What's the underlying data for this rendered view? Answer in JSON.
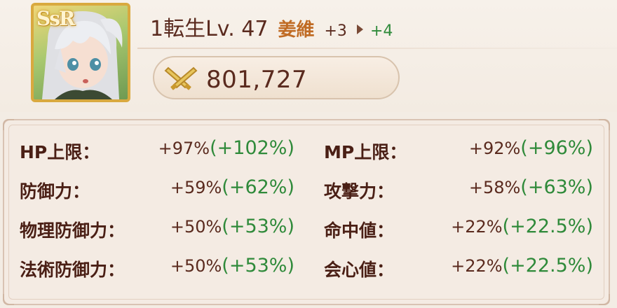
{
  "character": {
    "rarity": "SsR",
    "portrait": "white-haired-girl-portrait"
  },
  "header": {
    "rebirth_level": "1転生Lv. 47",
    "kind": "姜維",
    "from": "+3",
    "arrow_icon": "chevron-right-icon",
    "to": "+4"
  },
  "power": {
    "icon": "crossed-swords-icon",
    "value": "801,727"
  },
  "stats": {
    "left": [
      {
        "label": "HP上限：",
        "current": "+97%",
        "next": "(+102%)"
      },
      {
        "label": "防御力：",
        "current": "+59%",
        "next": "(+62%)"
      },
      {
        "label": "物理防御力：",
        "current": "+50%",
        "next": "(+53%)"
      },
      {
        "label": "法術防御力：",
        "current": "+50%",
        "next": "(+53%)"
      }
    ],
    "right": [
      {
        "label": "MP上限：",
        "current": "+92%",
        "next": "(+96%)"
      },
      {
        "label": "攻撃力：",
        "current": "+58%",
        "next": "(+63%)"
      },
      {
        "label": "命中値：",
        "current": "+22%",
        "next": "(+22.5%)"
      },
      {
        "label": "会心値：",
        "current": "+22%",
        "next": "(+22.5%)"
      }
    ]
  },
  "colors": {
    "background": "#f3ece4",
    "text_dark": "#5a2a1e",
    "accent_orange": "#c06b24",
    "accent_green": "#2f8a3a",
    "frame_gold": "#d9a93f"
  }
}
